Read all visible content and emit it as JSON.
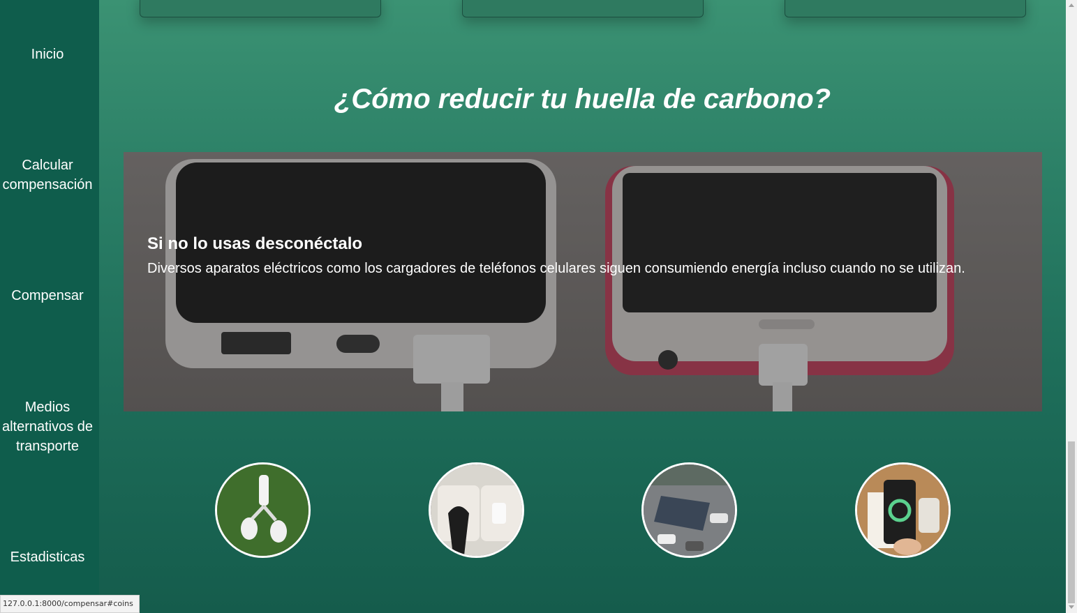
{
  "sidebar": {
    "items": [
      {
        "label": "Inicio"
      },
      {
        "label": "Calcular compensación"
      },
      {
        "label": "Compensar"
      },
      {
        "label": "Medios alternativos de transporte"
      },
      {
        "label": "Estadisticas"
      }
    ]
  },
  "main": {
    "section_title": "¿Cómo reducir tu huella de carbono?",
    "tip": {
      "title": "Si no lo usas desconéctalo",
      "text": "Diversos aparatos eléctricos como los cargadores de teléfonos celulares siguen consumiendo energía incluso cuando no se utilizan."
    },
    "tip_thumbnails": [
      {
        "icon": "light-bulbs-on-grass-icon"
      },
      {
        "icon": "wall-outlet-plug-icon"
      },
      {
        "icon": "solar-panels-parking-icon"
      },
      {
        "icon": "recycle-phone-icon"
      }
    ]
  },
  "status_bar": {
    "url": "127.0.0.1:8000/compensar#coins"
  },
  "colors": {
    "sidebar": "#0f5d4c",
    "accent": "#2b7f66"
  }
}
